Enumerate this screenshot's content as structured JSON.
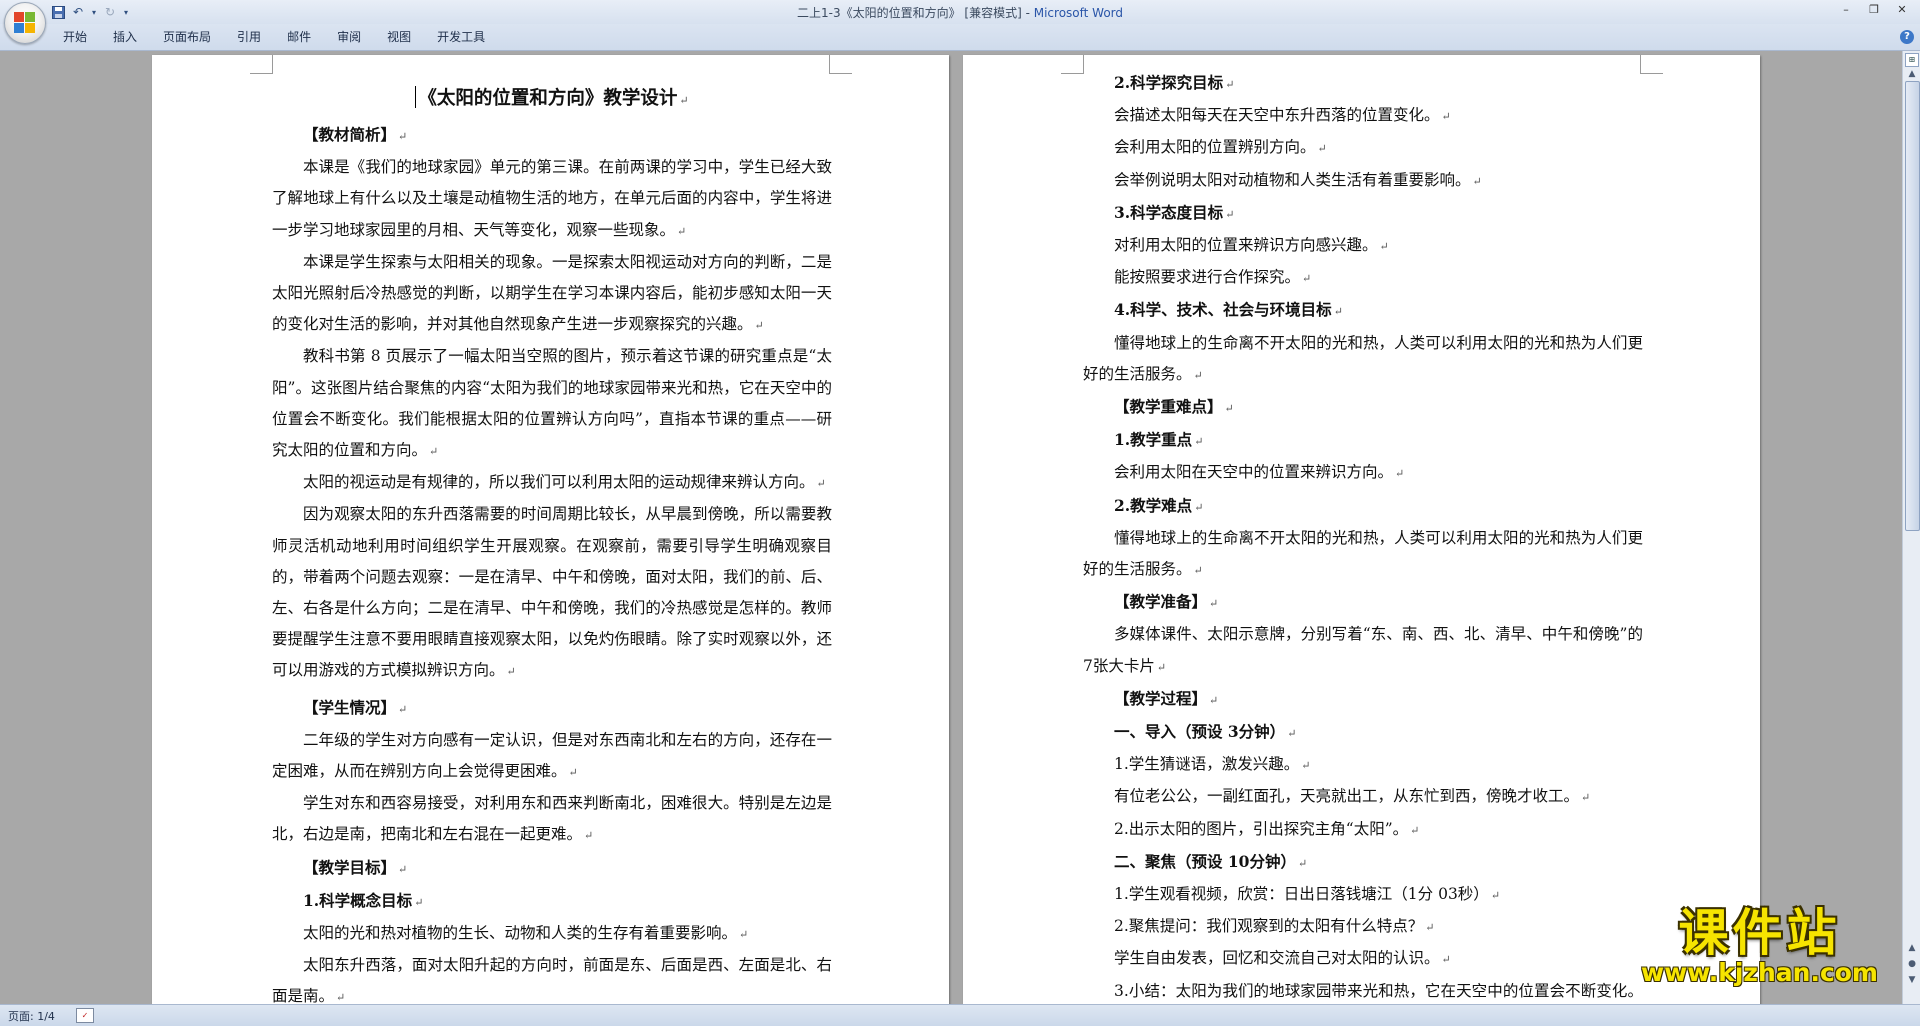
{
  "window": {
    "title_doc": "二上1-3《太阳的位置和方向》 [兼容模式] - ",
    "title_app": "Microsoft Word"
  },
  "quick_access": {
    "save_icon": "save-icon",
    "undo_icon": "undo-icon",
    "redo_icon": "redo-icon",
    "customize_icon": "customize-toolbar-icon"
  },
  "ribbon": {
    "tabs": [
      "开始",
      "插入",
      "页面布局",
      "引用",
      "邮件",
      "审阅",
      "视图",
      "开发工具"
    ]
  },
  "document": {
    "title": "《太阳的位置和方向》教学设计",
    "left_page": {
      "h_textbook": "【教材简析】",
      "p1": "本课是《我们的地球家园》单元的第三课。在前两课的学习中，学生已经大致了解地球上有什么以及土壤是动植物生活的地方，在单元后面的内容中，学生将进一步学习地球家园里的月相、天气等变化，观察一些现象。",
      "p2": "本课是学生探索与太阳相关的现象。一是探索太阳视运动对方向的判断，二是太阳光照射后冷热感觉的判断，以期学生在学习本课内容后，能初步感知太阳一天的变化对生活的影响，并对其他自然现象产生进一步观察探究的兴趣。",
      "p3": "教科书第 8 页展示了一幅太阳当空照的图片，预示着这节课的研究重点是“太阳”。这张图片结合聚焦的内容“太阳为我们的地球家园带来光和热，它在天空中的位置会不断变化。我们能根据太阳的位置辨认方向吗”，直指本节课的重点——研究太阳的位置和方向。",
      "p4": "太阳的视运动是有规律的，所以我们可以利用太阳的运动规律来辨认方向。",
      "p5": "因为观察太阳的东升西落需要的时间周期比较长，从早晨到傍晚，所以需要教师灵活机动地利用时间组织学生开展观察。在观察前，需要引导学生明确观察目的，带着两个问题去观察：一是在清早、中午和傍晚，面对太阳，我们的前、后、左、右各是什么方向；二是在清早、中午和傍晚，我们的冷热感觉是怎样的。教师要提醒学生注意不要用眼睛直接观察太阳，以免灼伤眼睛。除了实时观察以外，还可以用游戏的方式模拟辨识方向。",
      "h_students": "【学生情况】",
      "p6": "二年级的学生对方向感有一定认识，但是对东西南北和左右的方向，还存在一定困难，从而在辨别方向上会觉得更困难。",
      "p7": "学生对东和西容易接受，对利用东和西来判断南北，困难很大。特别是左边是北，右边是南，把南北和左右混在一起更难。",
      "h_goals": "【教学目标】",
      "h_goal1": "1.科学概念目标",
      "p8": "太阳的光和热对植物的生长、动物和人类的生存有着重要影响。",
      "p9": "太阳东升西落，面对太阳升起的方向时，前面是东、后面是西、左面是北、右面是南。"
    },
    "right_page": {
      "h_goal2": "2.科学探究目标",
      "r1": "会描述太阳每天在天空中东升西落的位置变化。",
      "r2": "会利用太阳的位置辨别方向。",
      "r3": "会举例说明太阳对动植物和人类生活有着重要影响。",
      "h_goal3": "3.科学态度目标",
      "r4": "对利用太阳的位置来辨识方向感兴趣。",
      "r5": "能按照要求进行合作探究。",
      "h_goal4": "4.科学、技术、社会与环境目标",
      "r6": "懂得地球上的生命离不开太阳的光和热，人类可以利用太阳的光和热为人们更好的生活服务。",
      "h_key": "【教学重难点】",
      "h_key1": "1.教学重点",
      "r7": "会利用太阳在天空中的位置来辨识方向。",
      "h_key2": "2.教学难点",
      "r8": "懂得地球上的生命离不开太阳的光和热，人类可以利用太阳的光和热为人们更好的生活服务。",
      "h_prep": "【教学准备】",
      "r9": "多媒体课件、太阳示意牌，分别写着“东、南、西、北、清早、中午和傍晚”的 7张大卡片",
      "h_process": "【教学过程】",
      "h_step1": "一、导入（预设 3分钟）",
      "r10": "1.学生猜谜语，激发兴趣。",
      "r11": "有位老公公，一副红面孔，天亮就出工，从东忙到西，傍晚才收工。",
      "r12": "2.出示太阳的图片，引出探究主角“太阳”。",
      "h_step2": "二、聚焦（预设 10分钟）",
      "r13": "1.学生观看视频，欣赏：日出日落钱塘江（1分 03秒）",
      "r14": "2.聚焦提问：我们观察到的太阳有什么特点？",
      "r15": "学生自由发表，回忆和交流自己对太阳的认识。",
      "r16": "3.小结：太阳为我们的地球家园带来光和热，它在天空中的位置会不断变化。"
    }
  },
  "status": {
    "page_count": "页面: 1/4"
  },
  "watermark": {
    "name": "课件站",
    "url": "www.kjzhan.com"
  }
}
